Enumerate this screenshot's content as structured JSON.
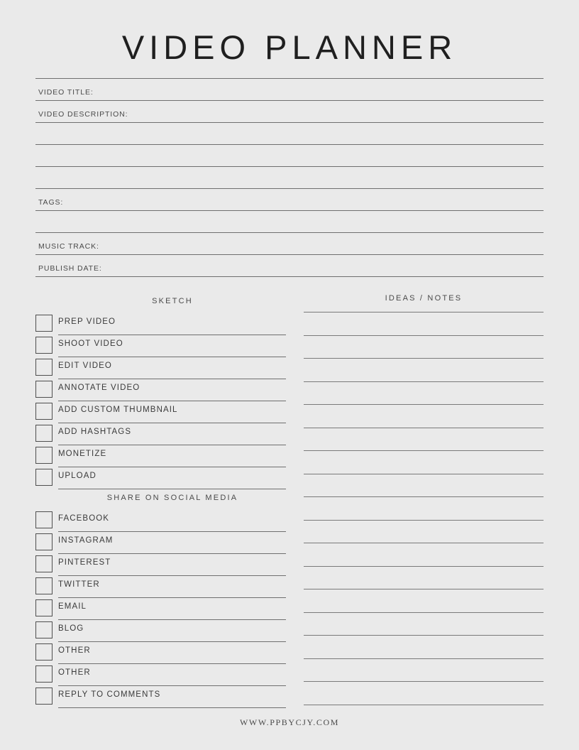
{
  "document": {
    "title": "VIDEO PLANNER",
    "background_color": "#eaeaea",
    "rule_color": "#6f6f6f",
    "text_color": "#3c3c3c"
  },
  "form": {
    "fields": [
      {
        "label": "VIDEO TITLE:"
      },
      {
        "label": "VIDEO DESCRIPTION:"
      },
      {
        "label": ""
      },
      {
        "label": ""
      },
      {
        "label": ""
      },
      {
        "label": "TAGS:"
      },
      {
        "label": ""
      },
      {
        "label": "MUSIC TRACK:"
      },
      {
        "label": "PUBLISH DATE:"
      }
    ]
  },
  "sketch": {
    "heading": "SKETCH",
    "items": [
      {
        "label": "PREP VIDEO",
        "checked": false
      },
      {
        "label": "SHOOT VIDEO",
        "checked": false
      },
      {
        "label": "EDIT VIDEO",
        "checked": false
      },
      {
        "label": "ANNOTATE VIDEO",
        "checked": false
      },
      {
        "label": "ADD CUSTOM THUMBNAIL",
        "checked": false
      },
      {
        "label": "ADD HASHTAGS",
        "checked": false
      },
      {
        "label": "MONETIZE",
        "checked": false
      },
      {
        "label": "UPLOAD",
        "checked": false
      }
    ]
  },
  "social": {
    "heading": "SHARE ON SOCIAL MEDIA",
    "items": [
      {
        "label": "FACEBOOK",
        "checked": false
      },
      {
        "label": "INSTAGRAM",
        "checked": false
      },
      {
        "label": "PINTEREST",
        "checked": false
      },
      {
        "label": "TWITTER",
        "checked": false
      },
      {
        "label": "EMAIL",
        "checked": false
      },
      {
        "label": "BLOG",
        "checked": false
      },
      {
        "label": "OTHER",
        "checked": false
      },
      {
        "label": "OTHER",
        "checked": false
      },
      {
        "label": "REPLY TO COMMENTS",
        "checked": false
      }
    ]
  },
  "notes": {
    "heading": "IDEAS / NOTES",
    "line_count": 18,
    "lines": [
      "",
      "",
      "",
      "",
      "",
      "",
      "",
      "",
      "",
      "",
      "",
      "",
      "",
      "",
      "",
      "",
      "",
      ""
    ]
  },
  "footer": {
    "text": "WWW.PPBYCJY.COM"
  }
}
